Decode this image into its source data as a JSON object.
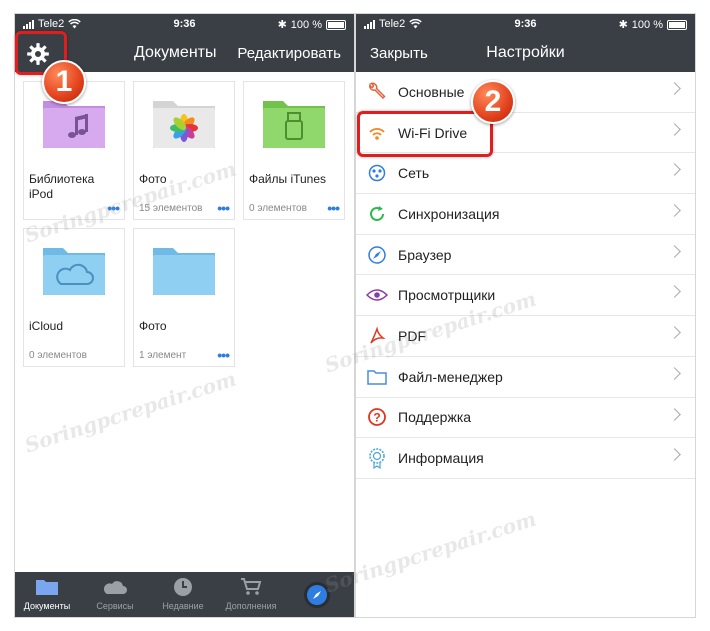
{
  "status_left": {
    "carrier": "Tele2",
    "time": "9:36",
    "battery": "100 %"
  },
  "status_right": {
    "carrier": "Tele2",
    "time": "9:36",
    "battery": "100 %"
  },
  "left": {
    "title": "Документы",
    "edit_label": "Редактировать",
    "gear_icon": "gear-icon",
    "tiles": [
      {
        "name": "Библиотека iPod",
        "count": "",
        "icon": "music-note-icon",
        "color": "#d7a9ef"
      },
      {
        "name": "Фото",
        "count": "15 элементов",
        "icon": "photos-icon",
        "color": "#e9e9e9"
      },
      {
        "name": "Файлы iTunes",
        "count": "0 элементов",
        "icon": "usb-icon",
        "color": "#90d86b"
      },
      {
        "name": "iCloud",
        "count": "0 элементов",
        "icon": "cloud-icon",
        "color": "#8fd0f2"
      },
      {
        "name": "Фото",
        "count": "1 элемент",
        "icon": "folder-icon",
        "color": "#8fd0f2"
      }
    ],
    "tabs": [
      {
        "label": "Документы",
        "icon": "folder-icon"
      },
      {
        "label": "Сервисы",
        "icon": "cloud-icon"
      },
      {
        "label": "Недавние",
        "icon": "clock-icon"
      },
      {
        "label": "Дополнения",
        "icon": "cart-icon"
      },
      {
        "label": "",
        "icon": "compass-icon"
      }
    ]
  },
  "right": {
    "close_label": "Закрыть",
    "title": "Настройки",
    "items": [
      {
        "label": "Основные",
        "icon": "wrench-icon",
        "color": "#e0623b"
      },
      {
        "label": "Wi-Fi Drive",
        "icon": "wifi-icon",
        "color": "#f08a2a"
      },
      {
        "label": "Сеть",
        "icon": "network-icon",
        "color": "#2f7de1"
      },
      {
        "label": "Синхронизация",
        "icon": "sync-icon",
        "color": "#2eb84b"
      },
      {
        "label": "Браузер",
        "icon": "compass-icon",
        "color": "#2f7de1"
      },
      {
        "label": "Просмотрщики",
        "icon": "eye-icon",
        "color": "#8a3ea8"
      },
      {
        "label": "PDF",
        "icon": "pdf-icon",
        "color": "#e0361f"
      },
      {
        "label": "Файл-менеджер",
        "icon": "folder-icon",
        "color": "#4a8be0"
      },
      {
        "label": "Поддержка",
        "icon": "help-icon",
        "color": "#e0361f"
      },
      {
        "label": "Информация",
        "icon": "info-badge-icon",
        "color": "#4aa6d9"
      }
    ]
  },
  "callouts": {
    "one": "1",
    "two": "2"
  },
  "watermark": "Soringpcrepair.com",
  "colors": {
    "bar": "#3a3f45",
    "accent": "#2f7de1",
    "highlight": "#e11d1d"
  }
}
